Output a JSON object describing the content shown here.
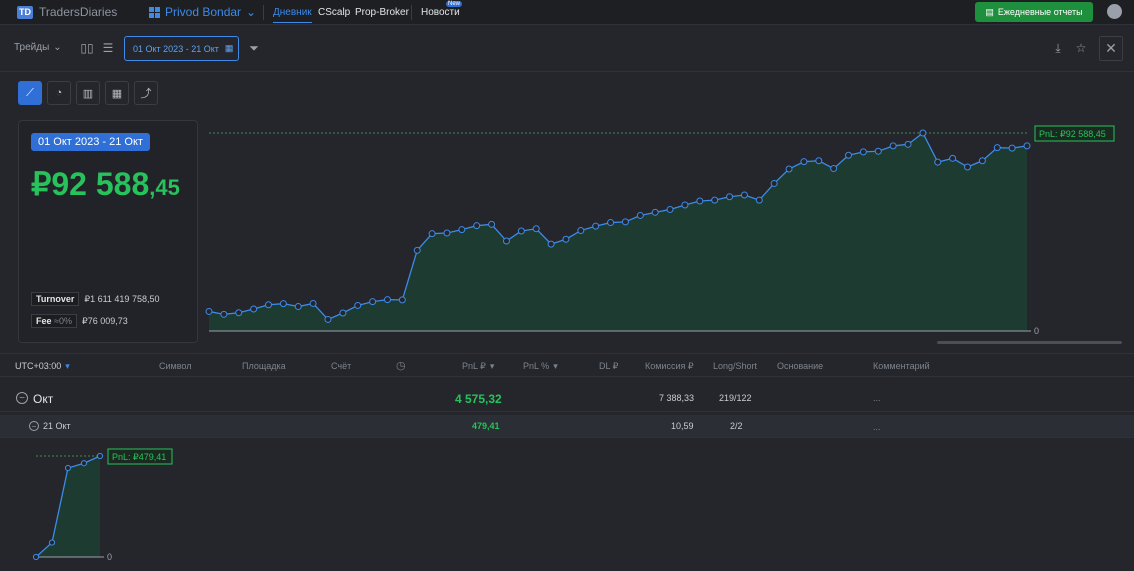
{
  "app": {
    "logo_text": "TradersDiaries",
    "logo_mark": "TD",
    "account_name": "Privod Bondar",
    "avatar_icon": "user-icon"
  },
  "nav": {
    "journal": "Дневник",
    "cscalp": "CScalp",
    "propbroker": "Prop-Broker",
    "news": "Новости",
    "news_badge": "New"
  },
  "report_button": "Ежедневные отчеты",
  "toolbar": {
    "trades_label": "Трейды",
    "date_range": "01 Окт 2023 - 21 Окт"
  },
  "summary": {
    "range_label": "01 Окт 2023 - 21 Окт",
    "pnl_main": "₽92 588",
    "pnl_cents": ",45",
    "turnover_label": "Turnover",
    "turnover_value": "₽1 611 419 758,50",
    "fee_label": "Fee",
    "fee_pct": "≈0%",
    "fee_value": "₽76 009,73"
  },
  "table": {
    "headers": {
      "tz": "UTC+03:00",
      "symbol": "Символ",
      "venue": "Площадка",
      "account": "Счёт",
      "pnl": "PnL ₽",
      "pnl_pct": "PnL %",
      "dl": "DL ₽",
      "commission": "Комиссия ₽",
      "longshort": "Long/Short",
      "basis": "Основание",
      "comment": "Комментарий"
    },
    "month_row": {
      "label": "Окт",
      "pnl": "4 575,32",
      "commission": "7 388,33",
      "longshort": "219/122",
      "comment": "..."
    },
    "day_row": {
      "label": "21 Окт",
      "pnl": "479,41",
      "commission": "10,59",
      "longshort": "2/2",
      "comment": "..."
    }
  },
  "chart_data": [
    {
      "type": "area",
      "series": [
        {
          "values": [
            88,
            75,
            82,
            99,
            118,
            123,
            110,
            124,
            52,
            81,
            115,
            132,
            141,
            140,
            363,
            438,
            441,
            456,
            474,
            480,
            405,
            450,
            460,
            391,
            413,
            452,
            472,
            488,
            491,
            520,
            534,
            547,
            567,
            585,
            589,
            604,
            612,
            589,
            664,
            729,
            762,
            766,
            731,
            791,
            806,
            809,
            833,
            840,
            891,
            760,
            777,
            738,
            766,
            825,
            823,
            833
          ]
        }
      ],
      "end_label": "PnL: ₽92 588,45",
      "zero_label": "0",
      "color": "#3d8ae8",
      "fill": "#1d3b30"
    },
    {
      "type": "area",
      "series": [
        {
          "values": [
            0,
            60,
            370,
            390,
            420
          ]
        }
      ],
      "end_label": "PnL: ₽479,41",
      "zero_label": "0",
      "color": "#3d8ae8",
      "fill": "#1d3b30"
    }
  ]
}
